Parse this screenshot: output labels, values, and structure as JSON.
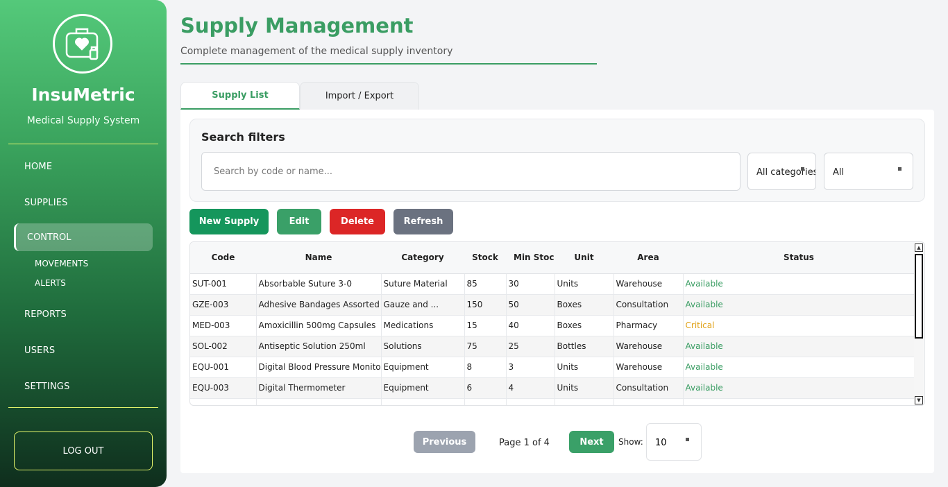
{
  "sidebar": {
    "brand": "InsuMetric",
    "brand_sub": "Medical Supply System",
    "nav": {
      "home": "HOME",
      "supplies": "SUPPLIES",
      "control": "CONTROL",
      "movements": "MOVEMENTS",
      "alerts": "ALERTS",
      "reports": "REPORTS",
      "users": "USERS",
      "settings": "SETTINGS"
    },
    "logout": "LOG OUT"
  },
  "header": {
    "title": "Supply Management",
    "subtitle": "Complete management of the medical supply inventory"
  },
  "tabs": {
    "list": "Supply List",
    "import_export": "Import / Export"
  },
  "filters": {
    "title": "Search filters",
    "search_placeholder": "Search by code or name...",
    "category_value": "All categories",
    "status_value": "All"
  },
  "actions": {
    "new": "New Supply",
    "edit": "Edit",
    "delete": "Delete",
    "refresh": "Refresh"
  },
  "table": {
    "headers": [
      "Code",
      "Name",
      "Category",
      "Stock",
      "Min Stock",
      "Unit",
      "Area",
      "Status"
    ],
    "rows": [
      [
        "SUT-001",
        "Absorbable Suture 3-0",
        "Suture Material",
        "85",
        "30",
        "Units",
        "Warehouse",
        "Available"
      ],
      [
        "GZE-003",
        "Adhesive Bandages Assorted",
        "Gauze and ...",
        "150",
        "50",
        "Boxes",
        "Consultation",
        "Available"
      ],
      [
        "MED-003",
        "Amoxicillin 500mg Capsules",
        "Medications",
        "15",
        "40",
        "Boxes",
        "Pharmacy",
        "Critical"
      ],
      [
        "SOL-002",
        "Antiseptic Solution 250ml",
        "Solutions",
        "75",
        "25",
        "Bottles",
        "Warehouse",
        "Available"
      ],
      [
        "EQU-001",
        "Digital Blood Pressure Monitor",
        "Equipment",
        "8",
        "3",
        "Units",
        "Warehouse",
        "Available"
      ],
      [
        "EQU-003",
        "Digital Thermometer",
        "Equipment",
        "6",
        "4",
        "Units",
        "Consultation",
        "Available"
      ],
      [
        "",
        "",
        "",
        "",
        "",
        "",
        "",
        ""
      ]
    ]
  },
  "pagination": {
    "previous": "Previous",
    "page_info": "Page 1 of 4",
    "next": "Next",
    "show_label": "Show:",
    "page_size": "10"
  },
  "colors": {
    "accent": "#3a9d63",
    "danger": "#dc2626",
    "neutral": "#6b7280",
    "critical": "#e0a116"
  }
}
